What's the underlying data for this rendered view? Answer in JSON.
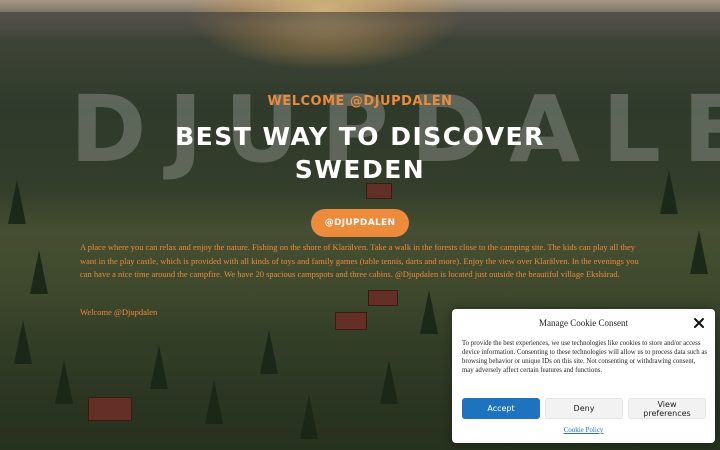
{
  "hero": {
    "watermark": "DJUPDALEN",
    "welcome": "WELCOME @DJUPDALEN",
    "title": "BEST WAY TO DISCOVER SWEDEN",
    "cta_label": "@DJUPDALEN",
    "description": "A place where you can relax and enjoy the nature. Fishing on the shore of Klarälven. Take a walk in the forests close to the camping site. The kids can play all they want in the play castle, which is provided with all kinds of toys and family games (table tennis, darts and more). Enjoy the view over Klarälven. In the evenings you can have a nice time around the campfire. We have 20 spacious campspots and three cabins. @Djupdalen is located just outside the beautiful village Ekshärad.",
    "signature": "Welcome @Djupdalen",
    "accent_color": "#ec8b3c"
  },
  "consent": {
    "title": "Manage Cookie Consent",
    "text": "To provide the best experiences, we use technologies like cookies to store and/or access device information. Consenting to these technologies will allow us to process data such as browsing behavior or unique IDs on this site. Not consenting or withdrawing consent, may adversely affect certain features and functions.",
    "accept_label": "Accept",
    "deny_label": "Deny",
    "preferences_label": "View preferences",
    "policy_link": "Cookie Policy",
    "close_icon": "close-icon",
    "accent_color": "#1e73be"
  }
}
